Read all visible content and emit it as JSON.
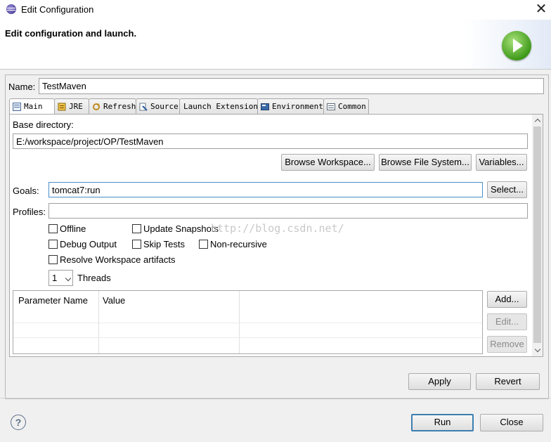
{
  "window": {
    "title": "Edit Configuration",
    "close_glyph": "✕"
  },
  "banner": {
    "heading": "Edit configuration and launch.",
    "icon": "run-launch-icon"
  },
  "name": {
    "label": "Name:",
    "value": "TestMaven"
  },
  "tabs": [
    {
      "label": "Main",
      "icon": "main-tab-icon",
      "active": true
    },
    {
      "label": "JRE",
      "icon": "jre-icon"
    },
    {
      "label": "Refresh",
      "icon": "refresh-icon"
    },
    {
      "label": "Source",
      "icon": "source-icon"
    },
    {
      "label": "Launch Extensions",
      "icon": ""
    },
    {
      "label": "Environment",
      "icon": "environment-icon"
    },
    {
      "label": "Common",
      "icon": "common-icon"
    }
  ],
  "main": {
    "base_dir_label": "Base directory:",
    "base_dir_value": "E:/workspace/project/OP/TestMaven",
    "browse_workspace": "Browse Workspace...",
    "browse_fs": "Browse File System...",
    "variables": "Variables...",
    "goals_label": "Goals:",
    "goals_value": "tomcat7:run",
    "select": "Select...",
    "profiles_label": "Profiles:",
    "profiles_value": "",
    "checkboxes": {
      "offline": "Offline",
      "update_snapshots": "Update Snapshots",
      "debug_output": "Debug Output",
      "skip_tests": "Skip Tests",
      "non_recursive": "Non-recursive",
      "resolve_workspace": "Resolve Workspace artifacts"
    },
    "threads_value": "1",
    "threads_label": "Threads",
    "params_columns": [
      "Parameter Name",
      "Value"
    ],
    "add": "Add...",
    "edit": "Edit...",
    "remove": "Remove"
  },
  "watermark": "http://blog.csdn.net/",
  "actions": {
    "apply": "Apply",
    "revert": "Revert"
  },
  "footer": {
    "help_glyph": "?",
    "run": "Run",
    "close": "Close"
  }
}
